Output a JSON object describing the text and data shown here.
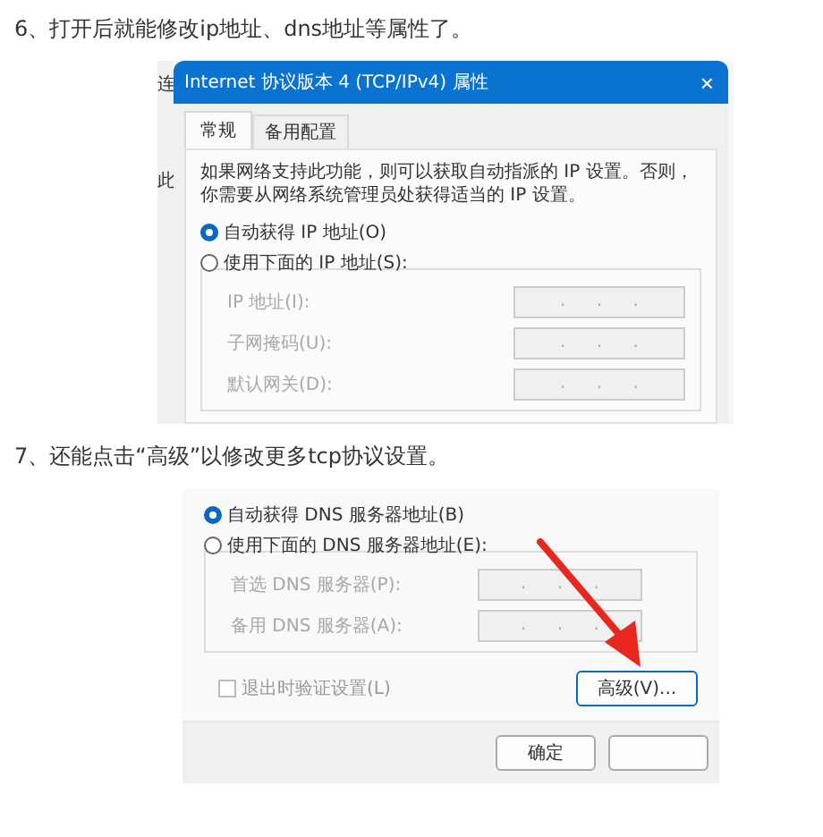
{
  "step_6": {
    "heading": "6、打开后就能修改ip地址、dns地址等属性了。",
    "background_window": {
      "labels": [
        "连",
        "此"
      ]
    },
    "dialog": {
      "title": "Internet 协议版本 4 (TCP/IPv4) 属性",
      "close": "×",
      "tabs": [
        {
          "label": "常规",
          "selected": true
        },
        {
          "label": "备用配置",
          "selected": false
        }
      ],
      "description": "如果网络支持此功能，则可以获取自动指派的 IP 设置。否则，你需要从网络系统管理员处获得适当的 IP 设置。",
      "radios": [
        {
          "label": "自动获得 IP 地址(O)",
          "selected": true
        },
        {
          "label": "使用下面的 IP 地址(S):",
          "selected": false
        }
      ],
      "fields": [
        {
          "label": "IP 地址(I):",
          "value": ". . .",
          "disabled": true
        },
        {
          "label": "子网掩码(U):",
          "value": ". . .",
          "disabled": true
        },
        {
          "label": "默认网关(D):",
          "value": ". . .",
          "disabled": true
        }
      ]
    }
  },
  "step_7": {
    "heading": "7、还能点击“高级”以修改更多tcp协议设置。",
    "dialog": {
      "radios": [
        {
          "label": "自动获得 DNS 服务器地址(B)",
          "selected": true
        },
        {
          "label": "使用下面的 DNS 服务器地址(E):",
          "selected": false
        }
      ],
      "fields": [
        {
          "label": "首选 DNS 服务器(P):",
          "value": ". . .",
          "disabled": true
        },
        {
          "label": "备用 DNS 服务器(A):",
          "value": ". . .",
          "disabled": true
        }
      ],
      "checkbox": {
        "label": "退出时验证设置(L)",
        "checked": false,
        "disabled": true
      },
      "advanced_button": "高级(V)...",
      "buttons": [
        "确定"
      ]
    }
  }
}
